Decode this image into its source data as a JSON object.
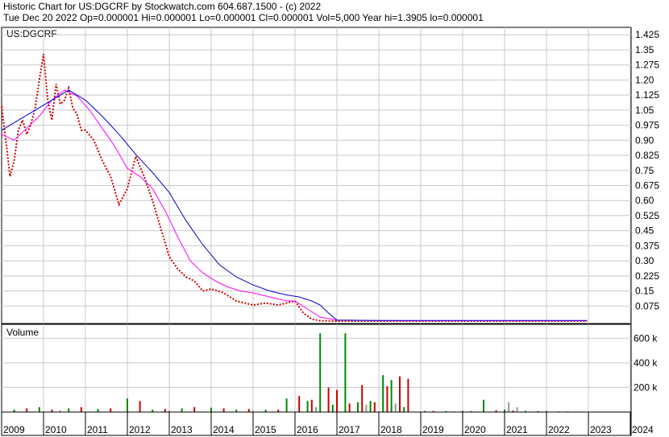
{
  "header": {
    "line1": "Historic Chart for US:DGCRF by Stockwatch.com 604.687.1500 - (c) 2022",
    "line2": "Tue Dec 20 2022   Op=0.000001   Hi=0.000001   Lo=0.000001   Cl=0.000001   Vol=5,000   Year hi=1.3905   lo=0.000001"
  },
  "chart_data": [
    {
      "type": "line",
      "title": "US:DGCRF",
      "ylim": [
        0,
        1.45
      ],
      "y_ticks": [
        "1.425",
        "1.35",
        "1.275",
        "1.20",
        "1.125",
        "1.05",
        "0.975",
        "0.90",
        "0.825",
        "0.75",
        "0.675",
        "0.60",
        "0.525",
        "0.45",
        "0.375",
        "0.30",
        "0.225",
        "0.15",
        "0.075"
      ],
      "x_ticks": [
        "2009",
        "2010",
        "2011",
        "2012",
        "2013",
        "2014",
        "2015",
        "2016",
        "2017",
        "2018",
        "2019",
        "2020",
        "2021",
        "2022",
        "2023",
        "2024"
      ],
      "grid": true,
      "series": [
        {
          "color": "#cc0000",
          "x": [
            2009.0,
            2009.1,
            2009.2,
            2009.3,
            2009.4,
            2009.5,
            2009.6,
            2009.7,
            2009.8,
            2009.9,
            2010.0,
            2010.1,
            2010.2,
            2010.3,
            2010.4,
            2010.5,
            2010.6,
            2010.7,
            2010.8,
            2010.9,
            2011.0,
            2011.2,
            2011.4,
            2011.6,
            2011.8,
            2012.0,
            2012.2,
            2012.4,
            2012.6,
            2012.8,
            2013.0,
            2013.2,
            2013.4,
            2013.6,
            2013.8,
            2014.0,
            2014.3,
            2014.6,
            2015.0,
            2015.3,
            2015.6,
            2016.0,
            2016.2,
            2016.4,
            2016.6,
            2016.8,
            2017.0,
            2018.0,
            2019.0,
            2020.0,
            2021.0,
            2022.0,
            2022.97
          ],
          "values": [
            1.07,
            0.9,
            0.72,
            0.8,
            0.95,
            1.0,
            0.93,
            0.98,
            1.06,
            1.2,
            1.33,
            1.1,
            1.0,
            1.18,
            1.08,
            1.1,
            1.16,
            1.06,
            1.03,
            0.95,
            0.95,
            0.9,
            0.8,
            0.72,
            0.58,
            0.66,
            0.82,
            0.72,
            0.6,
            0.46,
            0.32,
            0.26,
            0.22,
            0.2,
            0.15,
            0.16,
            0.14,
            0.1,
            0.08,
            0.09,
            0.08,
            0.1,
            0.04,
            0.01,
            0.002,
            0.001,
            0.0,
            0.0,
            0.0,
            0.0,
            0.0,
            0.0,
            1e-06
          ]
        },
        {
          "color": "#ff00ff",
          "x": [
            2009.0,
            2009.3,
            2009.6,
            2009.9,
            2010.2,
            2010.5,
            2010.8,
            2011.1,
            2011.4,
            2011.7,
            2012.0,
            2012.3,
            2012.6,
            2012.9,
            2013.2,
            2013.5,
            2013.8,
            2014.1,
            2014.4,
            2014.7,
            2015.0,
            2015.4,
            2015.8,
            2016.0,
            2016.3,
            2016.6,
            2017.0,
            2018.0,
            2019.0,
            2020.0,
            2021.0,
            2022.0,
            2022.97
          ],
          "values": [
            0.93,
            0.9,
            0.96,
            1.02,
            1.1,
            1.15,
            1.12,
            1.05,
            0.96,
            0.87,
            0.76,
            0.72,
            0.66,
            0.55,
            0.42,
            0.3,
            0.24,
            0.2,
            0.17,
            0.15,
            0.14,
            0.12,
            0.1,
            0.1,
            0.06,
            0.02,
            0.005,
            0.003,
            0.002,
            0.002,
            0.002,
            0.002,
            0.002
          ]
        },
        {
          "color": "#0000cc",
          "x": [
            2009.0,
            2009.4,
            2009.8,
            2010.2,
            2010.6,
            2011.0,
            2011.4,
            2011.8,
            2012.2,
            2012.6,
            2013.0,
            2013.4,
            2013.8,
            2014.2,
            2014.6,
            2015.0,
            2015.4,
            2015.8,
            2016.1,
            2016.4,
            2016.6,
            2016.8,
            2017.0,
            2018.0,
            2019.0,
            2020.0,
            2021.0,
            2022.0,
            2022.97
          ],
          "values": [
            0.95,
            1.0,
            1.05,
            1.1,
            1.15,
            1.1,
            1.02,
            0.93,
            0.83,
            0.74,
            0.64,
            0.5,
            0.38,
            0.28,
            0.22,
            0.18,
            0.15,
            0.13,
            0.12,
            0.1,
            0.08,
            0.04,
            0.005,
            0.003,
            0.003,
            0.003,
            0.003,
            0.003,
            0.003
          ]
        }
      ]
    },
    {
      "type": "bar",
      "title": "Volume",
      "ylim": [
        0,
        700000
      ],
      "y_ticks": [
        "600 k",
        "400 k",
        "200 k"
      ],
      "series": [
        {
          "color": "#008800",
          "x": [
            2009.3,
            2009.9,
            2010.6,
            2011.3,
            2012.0,
            2012.6,
            2013.3,
            2014.0,
            2014.6,
            2015.3,
            2015.8,
            2016.3,
            2016.6,
            2016.9,
            2017.2,
            2017.5,
            2017.8,
            2018.1,
            2018.3,
            2018.6,
            2019.1,
            2019.6,
            2020.0,
            2020.5,
            2021.0,
            2021.5,
            2022.0,
            2022.5
          ],
          "values": [
            20000,
            40000,
            30000,
            25000,
            110000,
            20000,
            30000,
            35000,
            20000,
            20000,
            110000,
            90000,
            640000,
            60000,
            640000,
            80000,
            90000,
            300000,
            260000,
            40000,
            10000,
            8000,
            10000,
            100000,
            20000,
            10000,
            8000,
            5000
          ]
        },
        {
          "color": "#cc0000",
          "x": [
            2009.6,
            2010.2,
            2010.9,
            2011.6,
            2012.3,
            2012.9,
            2013.6,
            2014.3,
            2014.9,
            2015.6,
            2016.1,
            2016.4,
            2016.8,
            2017.0,
            2017.3,
            2017.6,
            2017.9,
            2018.2,
            2018.5,
            2018.7,
            2019.3,
            2020.2,
            2020.8,
            2021.2,
            2021.8,
            2022.3
          ],
          "values": [
            30000,
            20000,
            40000,
            30000,
            90000,
            25000,
            40000,
            30000,
            25000,
            20000,
            130000,
            100000,
            200000,
            180000,
            70000,
            220000,
            80000,
            210000,
            290000,
            270000,
            10000,
            8000,
            15000,
            12000,
            8000,
            5000
          ]
        },
        {
          "color": "#999999",
          "x": [
            2010.4,
            2013.0,
            2015.0,
            2016.5,
            2017.7,
            2018.4,
            2019.8,
            2021.1,
            2021.3,
            2022.7
          ],
          "values": [
            15000,
            12000,
            10000,
            40000,
            60000,
            70000,
            6000,
            80000,
            40000,
            5000
          ]
        }
      ]
    }
  ]
}
